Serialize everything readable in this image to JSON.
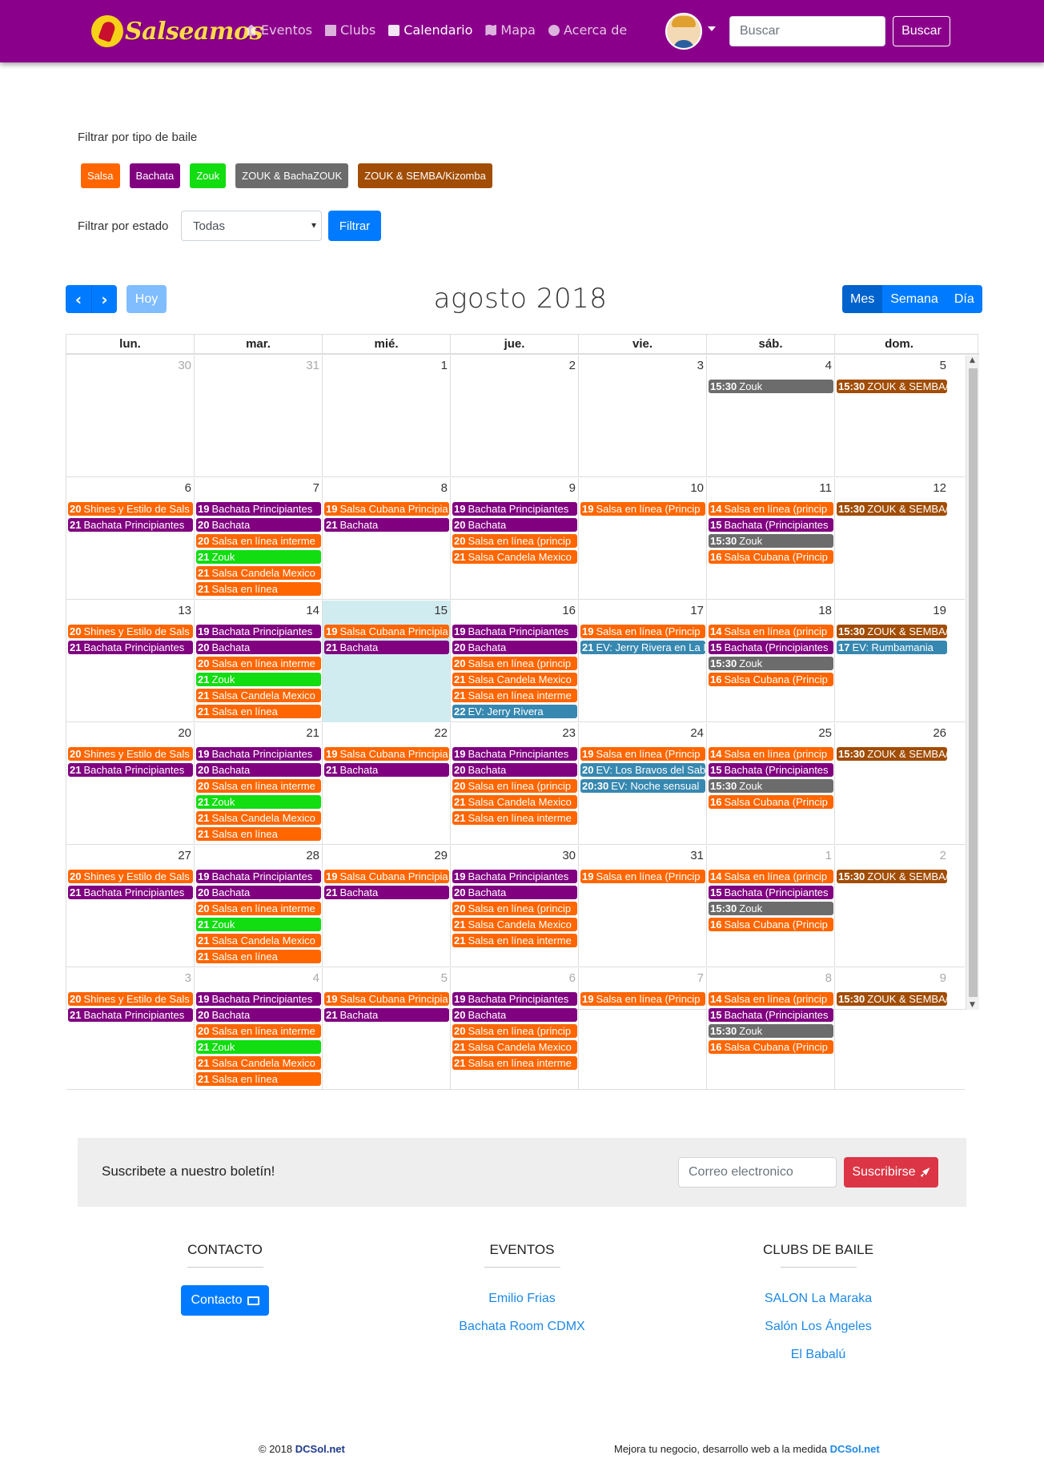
{
  "nav": {
    "brand": "Salseamos",
    "links": [
      {
        "label": "Eventos",
        "icon": "home-icon"
      },
      {
        "label": "Clubs",
        "icon": "building-icon"
      },
      {
        "label": "Calendario",
        "icon": "calendar-icon"
      },
      {
        "label": "Mapa",
        "icon": "map-icon"
      },
      {
        "label": "Acerca de",
        "icon": "info-icon"
      }
    ],
    "search_placeholder": "Buscar",
    "search_button": "Buscar"
  },
  "filters": {
    "dance_title": "Filtrar por tipo de baile",
    "tags": [
      {
        "label": "Salsa",
        "color": "#ff6600"
      },
      {
        "label": "Bachata",
        "color": "#800080"
      },
      {
        "label": "Zouk",
        "color": "#11dd11"
      },
      {
        "label": "ZOUK & BachaZOUK",
        "color": "#6c6c6c"
      },
      {
        "label": "ZOUK & SEMBA/Kizomba",
        "color": "#a14d05"
      }
    ],
    "status_label": "Filtrar por estado",
    "status_value": "Todas",
    "filter_button": "Filtrar"
  },
  "calendar": {
    "title": "agosto 2018",
    "today_button": "Hoy",
    "views": [
      "Mes",
      "Semana",
      "Día"
    ],
    "weekdays": [
      "lun.",
      "mar.",
      "mié.",
      "jue.",
      "vie.",
      "sáb.",
      "dom."
    ],
    "weeks": [
      [
        {
          "n": "30",
          "other": true,
          "events": []
        },
        {
          "n": "31",
          "other": true,
          "events": []
        },
        {
          "n": "1",
          "events": []
        },
        {
          "n": "2",
          "events": []
        },
        {
          "n": "3",
          "events": []
        },
        {
          "n": "4",
          "events": [
            {
              "t": "15:30",
              "title": "Zouk",
              "c": "zoukb"
            }
          ]
        },
        {
          "n": "5",
          "events": [
            {
              "t": "15:30",
              "title": "ZOUK & SEMBA/Ki",
              "c": "kiz"
            }
          ]
        }
      ],
      [
        {
          "n": "6",
          "events": [
            {
              "t": "20",
              "title": "Shines y Estilo de Sals",
              "c": "salsa"
            },
            {
              "t": "21",
              "title": "Bachata Principiantes",
              "c": "bachata"
            }
          ]
        },
        {
          "n": "7",
          "events": [
            {
              "t": "19",
              "title": "Bachata Principiantes",
              "c": "bachata"
            },
            {
              "t": "20",
              "title": "Bachata",
              "c": "bachata"
            },
            {
              "t": "20",
              "title": "Salsa en línea interme",
              "c": "salsa"
            },
            {
              "t": "21",
              "title": "Zouk",
              "c": "zouk"
            },
            {
              "t": "21",
              "title": "Salsa Candela Mexico",
              "c": "salsa"
            },
            {
              "t": "21",
              "title": "Salsa en línea",
              "c": "salsa"
            }
          ]
        },
        {
          "n": "8",
          "events": [
            {
              "t": "19",
              "title": "Salsa Cubana Principia",
              "c": "salsa"
            },
            {
              "t": "21",
              "title": "Bachata",
              "c": "bachata"
            }
          ]
        },
        {
          "n": "9",
          "events": [
            {
              "t": "19",
              "title": "Bachata Principiantes",
              "c": "bachata"
            },
            {
              "t": "20",
              "title": "Bachata",
              "c": "bachata"
            },
            {
              "t": "20",
              "title": "Salsa en línea (princip",
              "c": "salsa"
            },
            {
              "t": "21",
              "title": "Salsa Candela Mexico",
              "c": "salsa"
            }
          ]
        },
        {
          "n": "10",
          "events": [
            {
              "t": "19",
              "title": "Salsa en línea (Princip",
              "c": "salsa"
            }
          ]
        },
        {
          "n": "11",
          "events": [
            {
              "t": "14",
              "title": "Salsa en línea (princip",
              "c": "salsa"
            },
            {
              "t": "15",
              "title": "Bachata (Principiantes",
              "c": "bachata"
            },
            {
              "t": "15:30",
              "title": "Zouk",
              "c": "zoukb"
            },
            {
              "t": "16",
              "title": "Salsa Cubana (Princip",
              "c": "salsa"
            }
          ]
        },
        {
          "n": "12",
          "events": [
            {
              "t": "15:30",
              "title": "ZOUK & SEMBA/Ki",
              "c": "kiz"
            }
          ]
        }
      ],
      [
        {
          "n": "13",
          "events": [
            {
              "t": "20",
              "title": "Shines y Estilo de Sals",
              "c": "salsa"
            },
            {
              "t": "21",
              "title": "Bachata Principiantes",
              "c": "bachata"
            }
          ]
        },
        {
          "n": "14",
          "events": [
            {
              "t": "19",
              "title": "Bachata Principiantes",
              "c": "bachata"
            },
            {
              "t": "20",
              "title": "Bachata",
              "c": "bachata"
            },
            {
              "t": "20",
              "title": "Salsa en línea interme",
              "c": "salsa"
            },
            {
              "t": "21",
              "title": "Zouk",
              "c": "zouk"
            },
            {
              "t": "21",
              "title": "Salsa Candela Mexico",
              "c": "salsa"
            },
            {
              "t": "21",
              "title": "Salsa en línea",
              "c": "salsa"
            }
          ]
        },
        {
          "n": "15",
          "today": true,
          "events": [
            {
              "t": "19",
              "title": "Salsa Cubana Principia",
              "c": "salsa"
            },
            {
              "t": "21",
              "title": "Bachata",
              "c": "bachata"
            }
          ]
        },
        {
          "n": "16",
          "events": [
            {
              "t": "19",
              "title": "Bachata Principiantes",
              "c": "bachata"
            },
            {
              "t": "20",
              "title": "Bachata",
              "c": "bachata"
            },
            {
              "t": "20",
              "title": "Salsa en línea (princip",
              "c": "salsa"
            },
            {
              "t": "21",
              "title": "Salsa Candela Mexico",
              "c": "salsa"
            },
            {
              "t": "21",
              "title": "Salsa en línea interme",
              "c": "salsa"
            },
            {
              "t": "22",
              "title": "EV: Jerry Rivera",
              "c": "ev"
            }
          ]
        },
        {
          "n": "17",
          "events": [
            {
              "t": "19",
              "title": "Salsa en línea (Princip",
              "c": "salsa"
            },
            {
              "t": "21",
              "title": "EV: Jerry Rivera en La I",
              "c": "ev"
            }
          ]
        },
        {
          "n": "18",
          "events": [
            {
              "t": "14",
              "title": "Salsa en línea (princip",
              "c": "salsa"
            },
            {
              "t": "15",
              "title": "Bachata (Principiantes",
              "c": "bachata"
            },
            {
              "t": "15:30",
              "title": "Zouk",
              "c": "zoukb"
            },
            {
              "t": "16",
              "title": "Salsa Cubana (Princip",
              "c": "salsa"
            }
          ]
        },
        {
          "n": "19",
          "events": [
            {
              "t": "15:30",
              "title": "ZOUK & SEMBA/Ki",
              "c": "kiz"
            },
            {
              "t": "17",
              "title": "EV: Rumbamania",
              "c": "ev"
            }
          ]
        }
      ],
      [
        {
          "n": "20",
          "events": [
            {
              "t": "20",
              "title": "Shines y Estilo de Sals",
              "c": "salsa"
            },
            {
              "t": "21",
              "title": "Bachata Principiantes",
              "c": "bachata"
            }
          ]
        },
        {
          "n": "21",
          "events": [
            {
              "t": "19",
              "title": "Bachata Principiantes",
              "c": "bachata"
            },
            {
              "t": "20",
              "title": "Bachata",
              "c": "bachata"
            },
            {
              "t": "20",
              "title": "Salsa en línea interme",
              "c": "salsa"
            },
            {
              "t": "21",
              "title": "Zouk",
              "c": "zouk"
            },
            {
              "t": "21",
              "title": "Salsa Candela Mexico",
              "c": "salsa"
            },
            {
              "t": "21",
              "title": "Salsa en línea",
              "c": "salsa"
            }
          ]
        },
        {
          "n": "22",
          "events": [
            {
              "t": "19",
              "title": "Salsa Cubana Principia",
              "c": "salsa"
            },
            {
              "t": "21",
              "title": "Bachata",
              "c": "bachata"
            }
          ]
        },
        {
          "n": "23",
          "events": [
            {
              "t": "19",
              "title": "Bachata Principiantes",
              "c": "bachata"
            },
            {
              "t": "20",
              "title": "Bachata",
              "c": "bachata"
            },
            {
              "t": "20",
              "title": "Salsa en línea (princip",
              "c": "salsa"
            },
            {
              "t": "21",
              "title": "Salsa Candela Mexico",
              "c": "salsa"
            },
            {
              "t": "21",
              "title": "Salsa en línea interme",
              "c": "salsa"
            }
          ]
        },
        {
          "n": "24",
          "events": [
            {
              "t": "19",
              "title": "Salsa en línea (Princip",
              "c": "salsa"
            },
            {
              "t": "20",
              "title": "EV: Los Bravos del Sab",
              "c": "ev"
            },
            {
              "t": "20:30",
              "title": "EV: Noche sensual",
              "c": "ev"
            }
          ]
        },
        {
          "n": "25",
          "events": [
            {
              "t": "14",
              "title": "Salsa en línea (princip",
              "c": "salsa"
            },
            {
              "t": "15",
              "title": "Bachata (Principiantes",
              "c": "bachata"
            },
            {
              "t": "15:30",
              "title": "Zouk",
              "c": "zoukb"
            },
            {
              "t": "16",
              "title": "Salsa Cubana (Princip",
              "c": "salsa"
            }
          ]
        },
        {
          "n": "26",
          "events": [
            {
              "t": "15:30",
              "title": "ZOUK & SEMBA/Ki",
              "c": "kiz"
            }
          ]
        }
      ],
      [
        {
          "n": "27",
          "events": [
            {
              "t": "20",
              "title": "Shines y Estilo de Sals",
              "c": "salsa"
            },
            {
              "t": "21",
              "title": "Bachata Principiantes",
              "c": "bachata"
            }
          ]
        },
        {
          "n": "28",
          "events": [
            {
              "t": "19",
              "title": "Bachata Principiantes",
              "c": "bachata"
            },
            {
              "t": "20",
              "title": "Bachata",
              "c": "bachata"
            },
            {
              "t": "20",
              "title": "Salsa en línea interme",
              "c": "salsa"
            },
            {
              "t": "21",
              "title": "Zouk",
              "c": "zouk"
            },
            {
              "t": "21",
              "title": "Salsa Candela Mexico",
              "c": "salsa"
            },
            {
              "t": "21",
              "title": "Salsa en línea",
              "c": "salsa"
            }
          ]
        },
        {
          "n": "29",
          "events": [
            {
              "t": "19",
              "title": "Salsa Cubana Principia",
              "c": "salsa"
            },
            {
              "t": "21",
              "title": "Bachata",
              "c": "bachata"
            }
          ]
        },
        {
          "n": "30",
          "events": [
            {
              "t": "19",
              "title": "Bachata Principiantes",
              "c": "bachata"
            },
            {
              "t": "20",
              "title": "Bachata",
              "c": "bachata"
            },
            {
              "t": "20",
              "title": "Salsa en línea (princip",
              "c": "salsa"
            },
            {
              "t": "21",
              "title": "Salsa Candela Mexico",
              "c": "salsa"
            },
            {
              "t": "21",
              "title": "Salsa en línea interme",
              "c": "salsa"
            }
          ]
        },
        {
          "n": "31",
          "events": [
            {
              "t": "19",
              "title": "Salsa en línea (Princip",
              "c": "salsa"
            }
          ]
        },
        {
          "n": "1",
          "other": true,
          "events": [
            {
              "t": "14",
              "title": "Salsa en línea (princip",
              "c": "salsa"
            },
            {
              "t": "15",
              "title": "Bachata (Principiantes",
              "c": "bachata"
            },
            {
              "t": "15:30",
              "title": "Zouk",
              "c": "zoukb"
            },
            {
              "t": "16",
              "title": "Salsa Cubana (Princip",
              "c": "salsa"
            }
          ]
        },
        {
          "n": "2",
          "other": true,
          "events": [
            {
              "t": "15:30",
              "title": "ZOUK & SEMBA/Ki",
              "c": "kiz"
            }
          ]
        }
      ],
      [
        {
          "n": "3",
          "other": true,
          "events": [
            {
              "t": "20",
              "title": "Shines y Estilo de Sals",
              "c": "salsa"
            },
            {
              "t": "21",
              "title": "Bachata Principiantes",
              "c": "bachata"
            }
          ]
        },
        {
          "n": "4",
          "other": true,
          "events": [
            {
              "t": "19",
              "title": "Bachata Principiantes",
              "c": "bachata"
            },
            {
              "t": "20",
              "title": "Bachata",
              "c": "bachata"
            },
            {
              "t": "20",
              "title": "Salsa en línea interme",
              "c": "salsa"
            },
            {
              "t": "21",
              "title": "Zouk",
              "c": "zouk"
            },
            {
              "t": "21",
              "title": "Salsa Candela Mexico",
              "c": "salsa"
            },
            {
              "t": "21",
              "title": "Salsa en línea",
              "c": "salsa"
            }
          ]
        },
        {
          "n": "5",
          "other": true,
          "events": [
            {
              "t": "19",
              "title": "Salsa Cubana Principia",
              "c": "salsa"
            },
            {
              "t": "21",
              "title": "Bachata",
              "c": "bachata"
            }
          ]
        },
        {
          "n": "6",
          "other": true,
          "events": [
            {
              "t": "19",
              "title": "Bachata Principiantes",
              "c": "bachata"
            },
            {
              "t": "20",
              "title": "Bachata",
              "c": "bachata"
            },
            {
              "t": "20",
              "title": "Salsa en línea (princip",
              "c": "salsa"
            },
            {
              "t": "21",
              "title": "Salsa Candela Mexico",
              "c": "salsa"
            },
            {
              "t": "21",
              "title": "Salsa en línea interme",
              "c": "salsa"
            }
          ]
        },
        {
          "n": "7",
          "other": true,
          "events": [
            {
              "t": "19",
              "title": "Salsa en línea (Princip",
              "c": "salsa"
            }
          ]
        },
        {
          "n": "8",
          "other": true,
          "events": [
            {
              "t": "14",
              "title": "Salsa en línea (princip",
              "c": "salsa"
            },
            {
              "t": "15",
              "title": "Bachata (Principiantes",
              "c": "bachata"
            },
            {
              "t": "15:30",
              "title": "Zouk",
              "c": "zoukb"
            },
            {
              "t": "16",
              "title": "Salsa Cubana (Princip",
              "c": "salsa"
            }
          ]
        },
        {
          "n": "9",
          "other": true,
          "events": [
            {
              "t": "15:30",
              "title": "ZOUK & SEMBA/Ki",
              "c": "kiz"
            }
          ]
        }
      ]
    ]
  },
  "newsletter": {
    "title": "Suscribete a nuestro boletín!",
    "placeholder": "Correo electronico",
    "button": "Suscribirse"
  },
  "footer": {
    "contact_title": "CONTACTO",
    "contact_button": "Contacto",
    "events_title": "EVENTOS",
    "events": [
      "Emilio Frias",
      "Bachata Room CDMX"
    ],
    "clubs_title": "CLUBS DE BAILE",
    "clubs": [
      "SALON La Maraka",
      "Salón Los Ángeles",
      "El Babalú"
    ],
    "copyright_prefix": "© 2018",
    "copyright_brand": "DCSol.net",
    "tagline_prefix": "Mejora tu negocio, desarrollo web a la medida",
    "tagline_brand": "DCSol.net"
  }
}
